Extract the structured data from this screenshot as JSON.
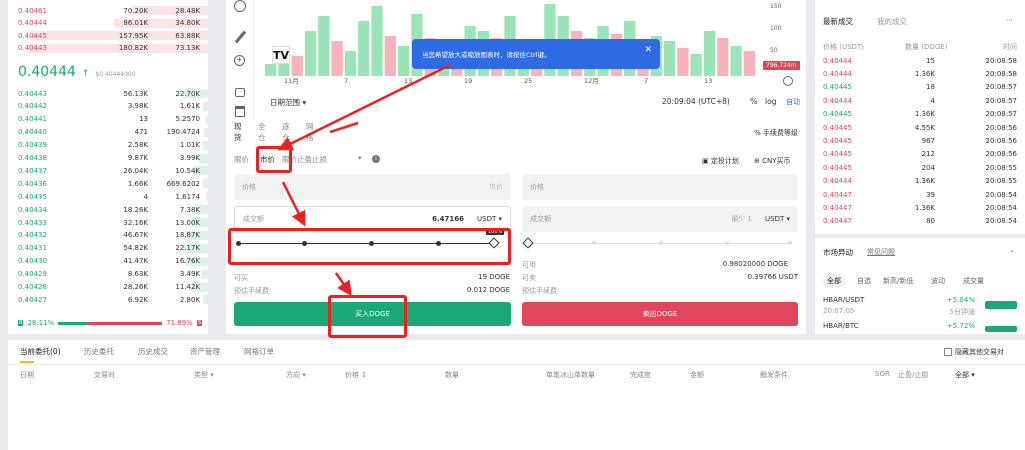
{
  "order_book": {
    "asks": [
      {
        "price": "0.40461",
        "amount": "70.20K",
        "total": "28.48K",
        "depth": 42
      },
      {
        "price": "0.40444",
        "amount": "86.01K",
        "total": "34.80K",
        "depth": 52
      },
      {
        "price": "0.40445",
        "amount": "157.95K",
        "total": "63.88K",
        "depth": 98
      },
      {
        "price": "0.40443",
        "amount": "180.82K",
        "total": "73.13K",
        "depth": 100
      }
    ],
    "last_price": "0.40444",
    "last_price_sub": "$0.40444000",
    "bids": [
      {
        "price": "0.40443",
        "amount": "56.13K",
        "total": "22.70K",
        "depth": 14
      },
      {
        "price": "0.40442",
        "amount": "3.98K",
        "total": "1.61K",
        "depth": 3
      },
      {
        "price": "0.40441",
        "amount": "13",
        "total": "5.2570",
        "depth": 1
      },
      {
        "price": "0.40440",
        "amount": "471",
        "total": "190.4724",
        "depth": 2
      },
      {
        "price": "0.40439",
        "amount": "2.58K",
        "total": "1.01K",
        "depth": 3
      },
      {
        "price": "0.40438",
        "amount": "9.87K",
        "total": "3.99K",
        "depth": 5
      },
      {
        "price": "0.40437",
        "amount": "26.04K",
        "total": "10.54K",
        "depth": 8
      },
      {
        "price": "0.40436",
        "amount": "1.66K",
        "total": "669.6202",
        "depth": 3
      },
      {
        "price": "0.40435",
        "amount": "4",
        "total": "1.6174",
        "depth": 1
      },
      {
        "price": "0.40434",
        "amount": "18.26K",
        "total": "7.38K",
        "depth": 6
      },
      {
        "price": "0.40433",
        "amount": "32.16K",
        "total": "13.00K",
        "depth": 9
      },
      {
        "price": "0.40432",
        "amount": "46.67K",
        "total": "18.87K",
        "depth": 12
      },
      {
        "price": "0.40431",
        "amount": "54.82K",
        "total": "22.17K",
        "depth": 14
      },
      {
        "price": "0.40430",
        "amount": "41.47K",
        "total": "16.76K",
        "depth": 12
      },
      {
        "price": "0.40429",
        "amount": "8.63K",
        "total": "3.49K",
        "depth": 4
      },
      {
        "price": "0.40428",
        "amount": "28.26K",
        "total": "11.42K",
        "depth": 9
      },
      {
        "price": "0.40427",
        "amount": "6.92K",
        "total": "2.80K",
        "depth": 3
      }
    ],
    "buy_ratio": "28.11%",
    "sell_ratio": "71.89%",
    "buy_ratio_value": 28.11
  },
  "chart": {
    "x_labels": [
      "11月",
      "7",
      "13",
      "19",
      "25",
      "12月",
      "7",
      "13"
    ],
    "y_labels": [
      "150",
      "100",
      "50"
    ],
    "price_tag": "796.724m",
    "date_range": "日期范围",
    "time": "20:09:04 (UTC+8)",
    "percent": "%",
    "log": "log",
    "auto": "自动",
    "bars": [
      12,
      30,
      20,
      45,
      60,
      35,
      25,
      55,
      70,
      40,
      30,
      62,
      38,
      20,
      28,
      50,
      45,
      38,
      60,
      35,
      30,
      72,
      60,
      45,
      38,
      50,
      42,
      55,
      30,
      40,
      35,
      28,
      22,
      45,
      38,
      30,
      25
    ],
    "bar_colors": [
      1,
      1,
      0,
      1,
      1,
      0,
      1,
      1,
      1,
      0,
      1,
      1,
      0,
      1,
      0,
      1,
      1,
      0,
      1,
      1,
      0,
      1,
      1,
      0,
      1,
      1,
      0,
      1,
      0,
      1,
      1,
      0,
      1,
      1,
      0,
      1,
      0
    ]
  },
  "tooltip": {
    "text": "当您希望放大或缩放图表时，请按住Ctrl键。",
    "close": "✕"
  },
  "trade": {
    "mode_tabs": [
      "现货",
      "全仓",
      "逐仓",
      "网格"
    ],
    "fee_label": "手续费等级",
    "order_types": [
      "限价",
      "市价",
      "限价止盈止损"
    ],
    "order_type_extra": "▾",
    "right_links": [
      "定投计划",
      "CNY买币"
    ],
    "buy": {
      "price_placeholder": "价格",
      "price_hint": "市价",
      "amount_label": "成交额",
      "amount_value": "6.47166",
      "amount_unit": "USDT ▾",
      "available_label": "可买",
      "available_value": "19 DOGE",
      "fee_label": "预估手续费",
      "fee_value": "0.012 DOGE",
      "button": "买入DOGE"
    },
    "sell": {
      "price_placeholder": "价格",
      "amount_label": "成交额",
      "amount_hint": "最少 1",
      "amount_unit": "USDT ▾",
      "available_label": "可用",
      "available_value": "0.98020000 DOGE",
      "available_label2": "可卖",
      "available_value2": "0.39766 USDT",
      "fee_label": "预估手续费",
      "button": "卖出DOGE"
    },
    "slider_badge": "100%",
    "slider_fraction": 1.0
  },
  "recent_trades": {
    "tabs": [
      "最新成交",
      "我的成交"
    ],
    "headers": [
      "价格 (USDT)",
      "数量 (DOGE)",
      "时间"
    ],
    "rows": [
      {
        "price": "0.40444",
        "amount": "15",
        "time": "20:08:58",
        "side": "sell"
      },
      {
        "price": "0.40444",
        "amount": "1.36K",
        "time": "20:08:58",
        "side": "sell"
      },
      {
        "price": "0.40445",
        "amount": "18",
        "time": "20:08:57",
        "side": "buy"
      },
      {
        "price": "0.40444",
        "amount": "4",
        "time": "20:08:57",
        "side": "sell"
      },
      {
        "price": "0.40445",
        "amount": "1.36K",
        "time": "20:08:57",
        "side": "buy"
      },
      {
        "price": "0.40445",
        "amount": "4.55K",
        "time": "20:08:56",
        "side": "sell"
      },
      {
        "price": "0.40445",
        "amount": "967",
        "time": "20:08:56",
        "side": "sell"
      },
      {
        "price": "0.40445",
        "amount": "212",
        "time": "20:08:56",
        "side": "sell"
      },
      {
        "price": "0.40445",
        "amount": "204",
        "time": "20:08:55",
        "side": "sell"
      },
      {
        "price": "0.40444",
        "amount": "1.36K",
        "time": "20:08:55",
        "side": "sell"
      },
      {
        "price": "0.40447",
        "amount": "39",
        "time": "20:08:54",
        "side": "sell"
      },
      {
        "price": "0.40447",
        "amount": "1.36K",
        "time": "20:08:54",
        "side": "sell"
      },
      {
        "price": "0.40447",
        "amount": "80",
        "time": "20:08:54",
        "side": "sell"
      }
    ]
  },
  "market_moves": {
    "title": "市场异动",
    "link": "常见问题",
    "tabs": [
      "全部",
      "自选",
      "新高/新低",
      "波动",
      "成交量"
    ],
    "items": [
      {
        "pair": "HBAR/USDT",
        "time": "20:07:05",
        "change": "+5.04%",
        "desc": "5分钟涨"
      },
      {
        "pair": "HBAR/BTC",
        "time": "",
        "change": "+5.72%",
        "desc": ""
      }
    ]
  },
  "bottom": {
    "tabs": [
      "当前委托(0)",
      "历史委托",
      "历史成交",
      "资产管理",
      "网格订单"
    ],
    "hide_label": "隐藏其他交易对",
    "columns": [
      "日期",
      "交易对",
      "类型 ▾",
      "方向 ▾",
      "价格 ↕",
      "数量",
      "单笔冰山单数量",
      "完成度",
      "金额",
      "触发条件",
      "SOR",
      "止盈/止损",
      "全部 ▾"
    ]
  },
  "left_toolbar_icons": [
    "clock-icon",
    "pen-icon",
    "zoom-in-icon",
    "lock-icon",
    "trash-icon"
  ]
}
